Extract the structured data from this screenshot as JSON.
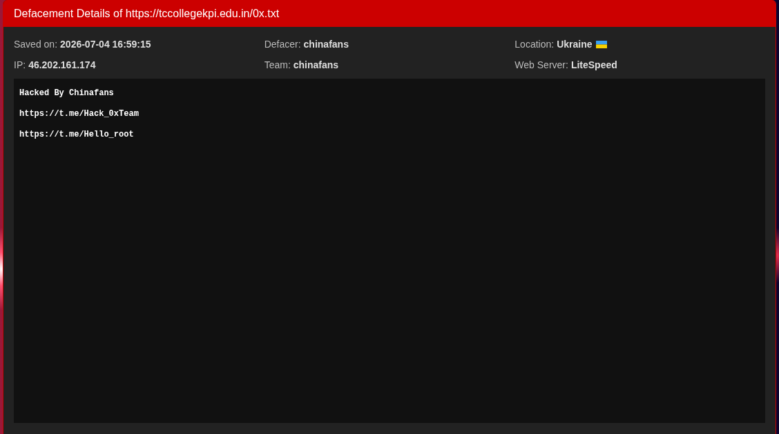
{
  "dialog": {
    "title": "Defacement Details of https://tccollegekpi.edu.in/0x.txt"
  },
  "details": [
    {
      "label": "Saved on:",
      "value": "2026-07-04 16:59:15",
      "flag": false
    },
    {
      "label": "Defacer:",
      "value": "chinafans",
      "flag": false
    },
    {
      "label": "Location:",
      "value": "Ukraine",
      "flag": true
    },
    {
      "label": "IP:",
      "value": "46.202.161.174",
      "flag": false
    },
    {
      "label": "Team:",
      "value": "chinafans",
      "flag": false
    },
    {
      "label": "Web Server:",
      "value": "LiteSpeed",
      "flag": false
    }
  ],
  "content": {
    "lines": [
      "Hacked By Chinafans",
      "https://t.me/Hack_0xTeam",
      "https://t.me/Hello_root"
    ]
  }
}
